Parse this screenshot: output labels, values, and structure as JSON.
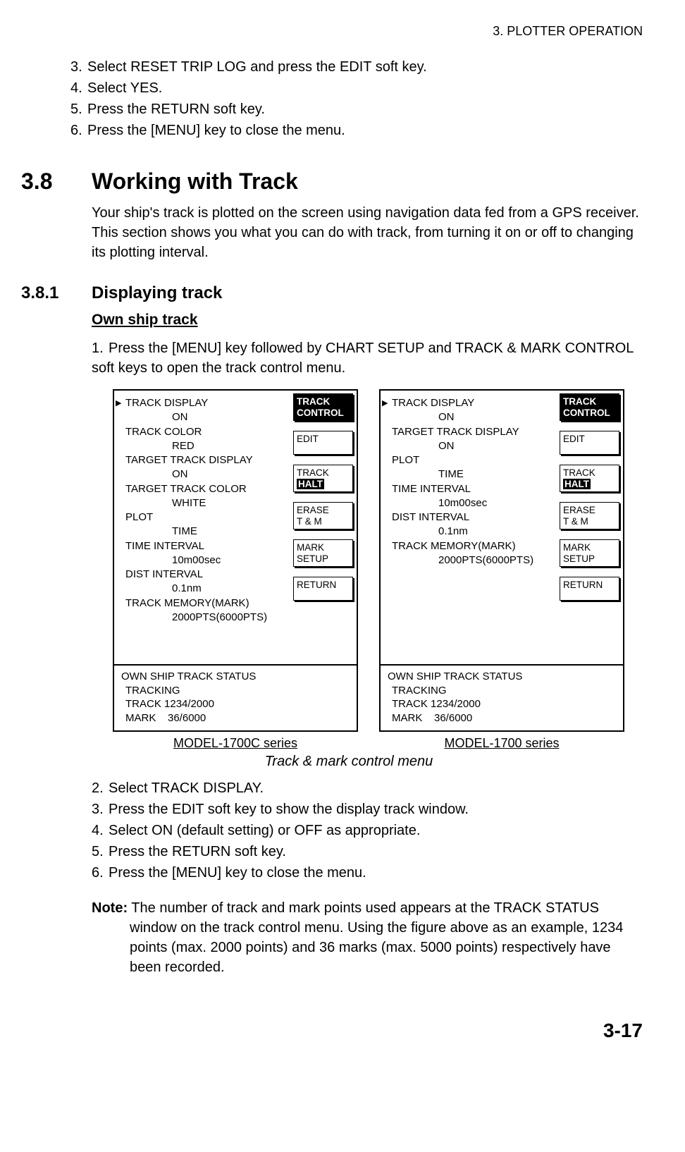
{
  "header": {
    "chapter": "3. PLOTTER OPERATION"
  },
  "top_steps": [
    {
      "n": "3.",
      "t": "Select RESET TRIP LOG and press the EDIT soft key."
    },
    {
      "n": "4.",
      "t": "Select YES."
    },
    {
      "n": "5.",
      "t": "Press the RETURN soft key."
    },
    {
      "n": "6.",
      "t": "Press the [MENU] key to close the menu."
    }
  ],
  "sec": {
    "num": "3.8",
    "title": "Working with Track",
    "para": "Your ship's track is plotted on the screen using navigation data fed from a GPS receiver. This section shows you what you can do with track, from turning it on or off to changing its plotting interval."
  },
  "subsec": {
    "num": "3.8.1",
    "title": "Displaying track",
    "sub_heading": "Own ship track",
    "step1": {
      "n": "1.",
      "t": "Press the [MENU] key followed by CHART SETUP and TRACK & MARK CONTROL soft keys to open the track control menu."
    }
  },
  "fig": {
    "panelA": {
      "items": [
        {
          "lbl": "TRACK DISPLAY",
          "val": "ON",
          "ptr": true
        },
        {
          "lbl": "TRACK COLOR",
          "val": "RED"
        },
        {
          "lbl": "TARGET TRACK DISPLAY",
          "val": "ON"
        },
        {
          "lbl": "TARGET TRACK COLOR",
          "val": "WHITE"
        },
        {
          "lbl": "PLOT",
          "val": "TIME"
        },
        {
          "lbl": "TIME INTERVAL",
          "val": "10m00sec"
        },
        {
          "lbl": "DIST INTERVAL",
          "val": "0.1nm"
        },
        {
          "lbl": "TRACK MEMORY(MARK)",
          "val": "2000PTS(6000PTS)"
        }
      ],
      "softkeys": {
        "title_l1": "TRACK",
        "title_l2": "CONTROL",
        "k1": "EDIT",
        "k2_l1": "TRACK",
        "k2_l2": "HALT",
        "k3_l1": "ERASE",
        "k3_l2": "T & M",
        "k4_l1": "MARK",
        "k4_l2": "SETUP",
        "k5": "RETURN"
      },
      "status": {
        "l1": "OWN SHIP TRACK STATUS",
        "l2": "TRACKING",
        "l3a": "TRACK 1234/2000",
        "l4a": "MARK",
        "l4b": "36/6000"
      },
      "label": "MODEL-1700C series"
    },
    "panelB": {
      "items": [
        {
          "lbl": "TRACK DISPLAY",
          "val": "ON",
          "ptr": true
        },
        {
          "lbl": "TARGET TRACK DISPLAY",
          "val": "ON"
        },
        {
          "lbl": "PLOT",
          "val": "TIME"
        },
        {
          "lbl": "TIME INTERVAL",
          "val": "10m00sec"
        },
        {
          "lbl": "DIST INTERVAL",
          "val": "0.1nm"
        },
        {
          "lbl": "TRACK MEMORY(MARK)",
          "val": "2000PTS(6000PTS)"
        }
      ],
      "softkeys": {
        "title_l1": "TRACK",
        "title_l2": "CONTROL",
        "k1": "EDIT",
        "k2_l1": "TRACK",
        "k2_l2": "HALT",
        "k3_l1": "ERASE",
        "k3_l2": "T & M",
        "k4_l1": "MARK",
        "k4_l2": "SETUP",
        "k5": "RETURN"
      },
      "status": {
        "l1": "OWN SHIP TRACK STATUS",
        "l2": "TRACKING",
        "l3a": "TRACK 1234/2000",
        "l4a": "MARK",
        "l4b": "36/6000"
      },
      "label": "MODEL-1700 series"
    },
    "caption": "Track & mark control menu"
  },
  "after_steps": [
    {
      "n": "2.",
      "t": "Select TRACK DISPLAY."
    },
    {
      "n": "3.",
      "t": "Press the EDIT soft key to show the display track window."
    },
    {
      "n": "4.",
      "t": "Select ON (default setting) or OFF as appropriate."
    },
    {
      "n": "5.",
      "t": "Press the RETURN soft key."
    },
    {
      "n": "6.",
      "t": "Press the [MENU] key to close the menu."
    }
  ],
  "note": {
    "label": "Note:",
    "first": " The number of track and mark points used appears at the TRACK STATUS",
    "rest": "window on the track control menu. Using the figure above as an example, 1234 points (max. 2000 points) and 36 marks (max. 5000 points) respectively have been recorded."
  },
  "page_num": "3-17"
}
